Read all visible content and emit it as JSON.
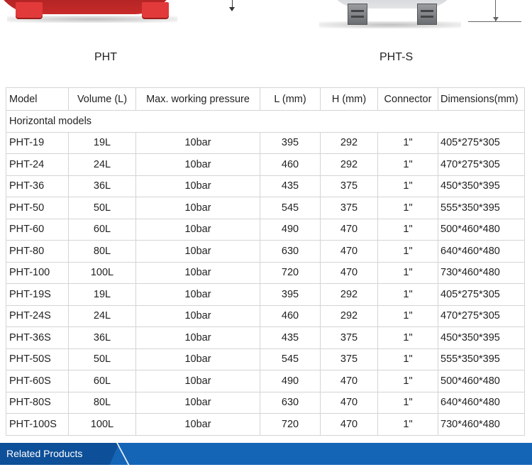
{
  "captions": {
    "left": "PHT",
    "right": "PHT-S"
  },
  "table": {
    "headers": [
      "Model",
      "Volume (L)",
      "Max. working pressure",
      "L (mm)",
      "H (mm)",
      "Connector",
      "Dimensions(mm)"
    ],
    "section_label": "Horizontal models",
    "rows": [
      [
        "PHT-19",
        "19L",
        "10bar",
        "395",
        "292",
        "1\"",
        "405*275*305"
      ],
      [
        "PHT-24",
        "24L",
        "10bar",
        "460",
        "292",
        "1\"",
        "470*275*305"
      ],
      [
        "PHT-36",
        "36L",
        "10bar",
        "435",
        "375",
        "1\"",
        "450*350*395"
      ],
      [
        "PHT-50",
        "50L",
        "10bar",
        "545",
        "375",
        "1\"",
        "555*350*395"
      ],
      [
        "PHT-60",
        "60L",
        "10bar",
        "490",
        "470",
        "1\"",
        "500*460*480"
      ],
      [
        "PHT-80",
        "80L",
        "10bar",
        "630",
        "470",
        "1\"",
        "640*460*480"
      ],
      [
        "PHT-100",
        "100L",
        "10bar",
        "720",
        "470",
        "1\"",
        "730*460*480"
      ],
      [
        "PHT-19S",
        "19L",
        "10bar",
        "395",
        "292",
        "1\"",
        "405*275*305"
      ],
      [
        "PHT-24S",
        "24L",
        "10bar",
        "460",
        "292",
        "1\"",
        "470*275*305"
      ],
      [
        "PHT-36S",
        "36L",
        "10bar",
        "435",
        "375",
        "1\"",
        "450*350*395"
      ],
      [
        "PHT-50S",
        "50L",
        "10bar",
        "545",
        "375",
        "1\"",
        "555*350*395"
      ],
      [
        "PHT-60S",
        "60L",
        "10bar",
        "490",
        "470",
        "1\"",
        "500*460*480"
      ],
      [
        "PHT-80S",
        "80L",
        "10bar",
        "630",
        "470",
        "1\"",
        "640*460*480"
      ],
      [
        "PHT-100S",
        "100L",
        "10bar",
        "720",
        "470",
        "1\"",
        "730*460*480"
      ]
    ]
  },
  "footer": {
    "label": "Related Products"
  },
  "colors": {
    "footer_bar": "#1565b7",
    "footer_tab": "#0d4f98",
    "tank_red": "#c92a2a",
    "tank_grey": "#b9bcc0",
    "table_border": "#d4d4d4"
  },
  "icons": {
    "product_left": "red-pressure-tank-image",
    "product_right": "grey-pressure-tank-image"
  }
}
